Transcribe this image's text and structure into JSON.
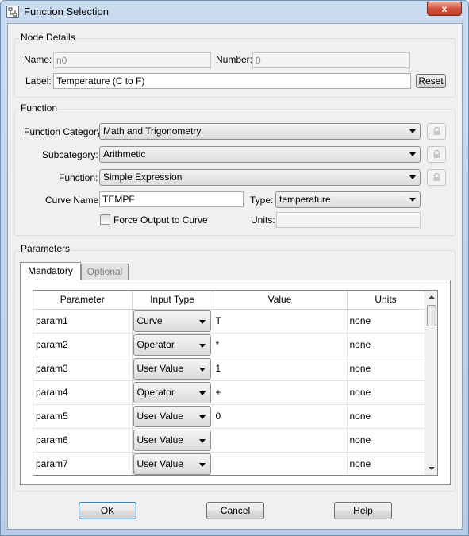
{
  "window": {
    "title": "Function Selection",
    "close_glyph": "x"
  },
  "node_details": {
    "title": "Node Details",
    "name_label": "Name:",
    "name_value": "n0",
    "number_label": "Number:",
    "number_value": "0",
    "label_label": "Label:",
    "label_value": "Temperature (C to F)",
    "reset_label": "Reset"
  },
  "function": {
    "title": "Function",
    "category_label": "Function Category:",
    "category_value": "Math and Trigonometry",
    "subcategory_label": "Subcategory:",
    "subcategory_value": "Arithmetic",
    "function_label": "Function:",
    "function_value": "Simple Expression",
    "curve_name_label": "Curve Name:",
    "curve_name_value": "TEMPF",
    "type_label": "Type:",
    "type_value": "temperature",
    "force_output_label": "Force Output to Curve",
    "units_label": "Units:",
    "units_value": ""
  },
  "parameters": {
    "title": "Parameters",
    "tabs": [
      {
        "label": "Mandatory"
      },
      {
        "label": "Optional"
      }
    ],
    "columns": [
      "Parameter",
      "Input Type",
      "Value",
      "Units"
    ],
    "rows": [
      {
        "parameter": "param1",
        "input_type": "Curve",
        "value": "T",
        "units": "none"
      },
      {
        "parameter": "param2",
        "input_type": "Operator",
        "value": "*",
        "units": "none"
      },
      {
        "parameter": "param3",
        "input_type": "User Value",
        "value": "1",
        "units": "none"
      },
      {
        "parameter": "param4",
        "input_type": "Operator",
        "value": "+",
        "units": "none"
      },
      {
        "parameter": "param5",
        "input_type": "User Value",
        "value": "0",
        "units": "none"
      },
      {
        "parameter": "param6",
        "input_type": "User Value",
        "value": "",
        "units": "none"
      },
      {
        "parameter": "param7",
        "input_type": "User Value",
        "value": "",
        "units": "none"
      }
    ]
  },
  "buttons": {
    "ok": "OK",
    "cancel": "Cancel",
    "help": "Help"
  },
  "icons": {
    "app": "function-graph-icon",
    "lock": "lock-icon",
    "dropdown": "chevron-down-icon"
  },
  "colors": {
    "title_bar": "#c9dbef",
    "close_button": "#c94a33",
    "default_button_border": "#3c7fb1"
  }
}
